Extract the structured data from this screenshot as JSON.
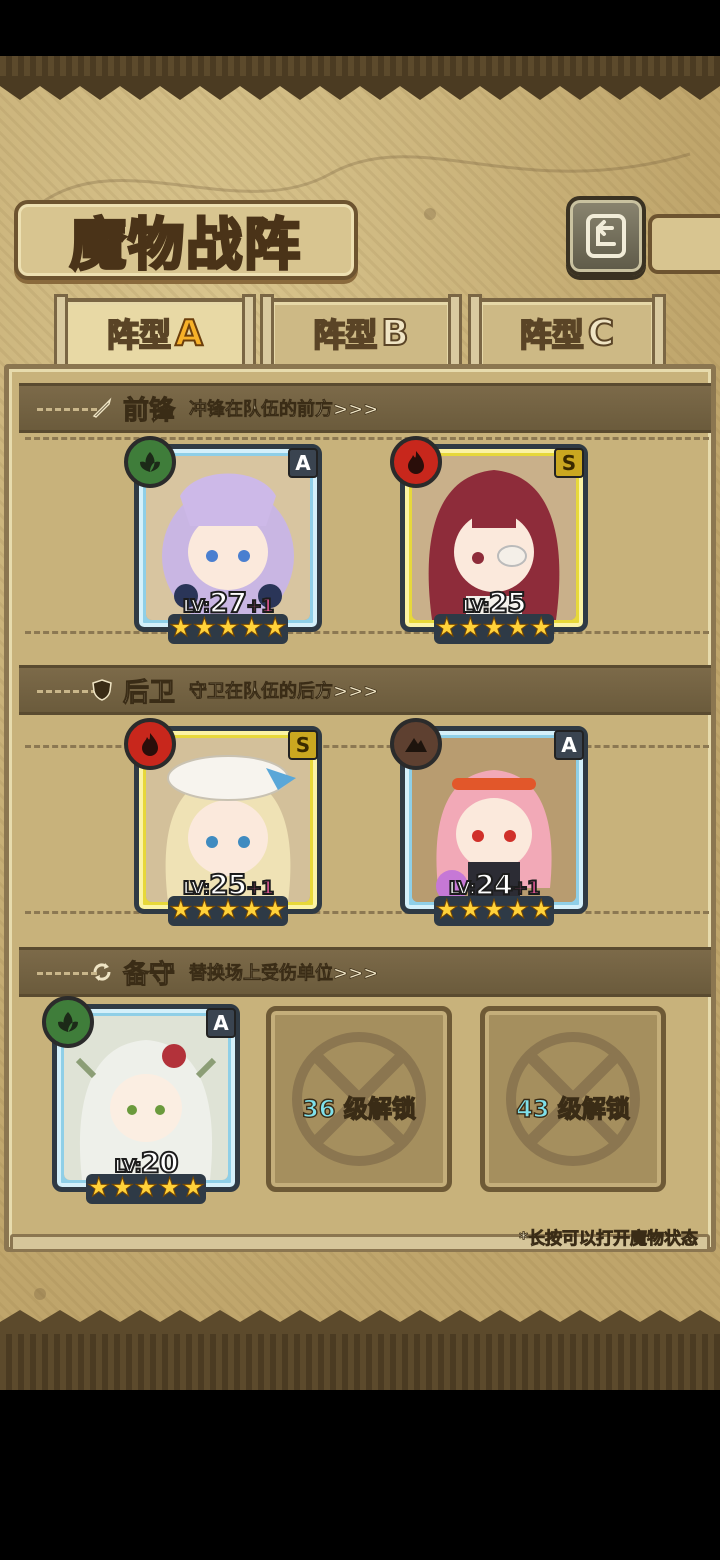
{
  "title": "魔物战阵",
  "back_icon": "back-arrow-icon",
  "tabs": [
    {
      "prefix": "阵型",
      "letter": "A",
      "active": true
    },
    {
      "prefix": "阵型",
      "letter": "B",
      "active": false
    },
    {
      "prefix": "阵型",
      "letter": "C",
      "active": false
    }
  ],
  "sections": {
    "front": {
      "icon": "sword-icon",
      "title": "前锋",
      "desc": "冲锋在队伍的前方>>>"
    },
    "back": {
      "icon": "shield-icon",
      "title": "后卫",
      "desc": "守卫在队伍的后方>>>"
    },
    "reserve": {
      "icon": "swap-icon",
      "title": "备守",
      "desc": "替换场上受伤单位>>>"
    }
  },
  "units": {
    "front_1": {
      "rank": "A",
      "element": "leaf",
      "level_prefix": "LV:",
      "level": "27",
      "plus": "+1",
      "stars": 5
    },
    "front_2": {
      "rank": "S",
      "element": "fire",
      "level_prefix": "LV:",
      "level": "25",
      "plus": "",
      "stars": 5
    },
    "back_1": {
      "rank": "S",
      "element": "fire",
      "level_prefix": "LV:",
      "level": "25",
      "plus": "+1",
      "stars": 5
    },
    "back_2": {
      "rank": "A",
      "element": "earth",
      "level_prefix": "LV:",
      "level": "24",
      "plus": "+1",
      "stars": 5
    },
    "reserve_1": {
      "rank": "A",
      "element": "leaf",
      "level_prefix": "LV:",
      "level": "20",
      "plus": "",
      "stars": 5
    }
  },
  "locked_slots": [
    {
      "level": "36",
      "suffix": "级解锁"
    },
    {
      "level": "43",
      "suffix": "级解锁"
    }
  ],
  "footnote": "*长按可以打开魔物状态",
  "colors": {
    "rank_a_frame": "#8fcfe7",
    "rank_s_frame": "#e7d83a",
    "star": "#ffd23a",
    "plus": "#ff5fa6",
    "lock_num": "#7fe0ea",
    "active_tab_letter": "#f7b128"
  }
}
